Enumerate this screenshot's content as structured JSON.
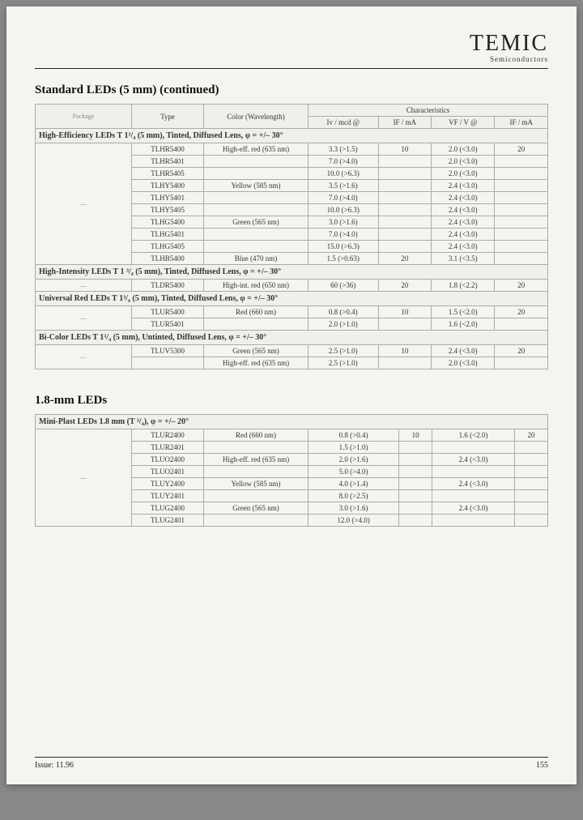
{
  "brand": {
    "name": "TEMIC",
    "sub": "Semiconductors"
  },
  "title1": "Standard LEDs (5 mm) (continued)",
  "headers": {
    "package": "Package",
    "type": "Type",
    "color": "Color (Wavelength)",
    "charGroup": "Characteristics",
    "iv": "Iv / mcd   @",
    "if": "IF / mA",
    "vf": "VF / V   @",
    "if2": "IF / mA"
  },
  "group1": {
    "title": "High-Efficiency LEDs  T 1³/₄ (5 mm), Tinted, Diffused Lens, φ = +/– 30°",
    "rows": [
      {
        "type": "TLHR5400",
        "color": "High-eff. red (635 nm)",
        "iv": "3.3 (>1.5)",
        "if": "10",
        "vf": "2.0 (<3.0)",
        "if2": "20"
      },
      {
        "type": "TLHR5401",
        "color": "",
        "iv": "7.0 (>4.0)",
        "if": "",
        "vf": "2.0 (<3.0)",
        "if2": ""
      },
      {
        "type": "TLHR5405",
        "color": "",
        "iv": "10.0 (>6.3)",
        "if": "",
        "vf": "2.0 (<3.0)",
        "if2": ""
      },
      {
        "type": "TLHY5400",
        "color": "Yellow (585 nm)",
        "iv": "3.5 (>1.6)",
        "if": "",
        "vf": "2.4 (<3.0)",
        "if2": ""
      },
      {
        "type": "TLHY5401",
        "color": "",
        "iv": "7.0 (>4.0)",
        "if": "",
        "vf": "2.4 (<3.0)",
        "if2": ""
      },
      {
        "type": "TLHY5405",
        "color": "",
        "iv": "10.0 (>6.3)",
        "if": "",
        "vf": "2.4 (<3.0)",
        "if2": ""
      },
      {
        "type": "TLHG5400",
        "color": "Green (565 nm)",
        "iv": "3.0 (>1.6)",
        "if": "",
        "vf": "2.4 (<3.0)",
        "if2": ""
      },
      {
        "type": "TLHG5401",
        "color": "",
        "iv": "7.0 (>4.0)",
        "if": "",
        "vf": "2.4 (<3.0)",
        "if2": ""
      },
      {
        "type": "TLHG5405",
        "color": "",
        "iv": "15.0 (>6.3)",
        "if": "",
        "vf": "2.4 (<3.0)",
        "if2": ""
      },
      {
        "type": "TLHB5400",
        "color": "Blue (470 nm)",
        "iv": "1.5 (>0.63)",
        "if": "20",
        "vf": "3.1 (<3.5)",
        "if2": ""
      }
    ]
  },
  "group2": {
    "title": "High-Intensity LEDs  T 1 ³/₄ (5 mm), Tinted, Diffused Lens, φ = +/– 30°",
    "rows": [
      {
        "type": "TLDR5400",
        "color": "High-int. red (650 nm)",
        "iv": "60 (>36)",
        "if": "20",
        "vf": "1.8 (<2.2)",
        "if2": "20"
      }
    ]
  },
  "group3": {
    "title": "Universal Red LEDs  T 1³/₄ (5 mm), Tinted, Diffused Lens, φ = +/– 30°",
    "rows": [
      {
        "type": "TLUR5400",
        "color": "Red (660 nm)",
        "iv": "0.8 (>0.4)",
        "if": "10",
        "vf": "1.5 (<2.0)",
        "if2": "20"
      },
      {
        "type": "TLUR5401",
        "color": "",
        "iv": "2.0 (>1.0)",
        "if": "",
        "vf": "1.6 (<2.0)",
        "if2": ""
      }
    ]
  },
  "group4": {
    "title": "Bi-Color LEDs  T 1³/₄ (5 mm), Untinted, Diffused Lens, φ = +/– 30°",
    "rows": [
      {
        "type": "TLUV5300",
        "color": "Green (565 nm)",
        "iv": "2.5 (>1.0)",
        "if": "10",
        "vf": "2.4 (<3.0)",
        "if2": "20"
      },
      {
        "type": "",
        "color": "High-eff. red (635 nm)",
        "iv": "2.5 (>1.0)",
        "if": "",
        "vf": "2.0 (<3.0)",
        "if2": ""
      }
    ]
  },
  "title2": "1.8-mm LEDs",
  "group5": {
    "title": "Mini-Plast LEDs  1.8 mm (T ³/₄),  φ = +/– 20°",
    "rows": [
      {
        "type": "TLUR2400",
        "color": "Red (660 nm)",
        "iv": "0.8 (>0.4)",
        "if": "10",
        "vf": "1.6 (<2.0)",
        "if2": "20"
      },
      {
        "type": "TLUR2401",
        "color": "",
        "iv": "1.5 (>1.0)",
        "if": "",
        "vf": "",
        "if2": ""
      },
      {
        "type": "TLUO2400",
        "color": "High-eff. red (635 nm)",
        "iv": "2.0 (>1.6)",
        "if": "",
        "vf": "2.4 (<3.0)",
        "if2": ""
      },
      {
        "type": "TLUO2401",
        "color": "",
        "iv": "5.0 (>4.0)",
        "if": "",
        "vf": "",
        "if2": ""
      },
      {
        "type": "TLUY2400",
        "color": "Yellow (585 nm)",
        "iv": "4.0 (>1.4)",
        "if": "",
        "vf": "2.4 (<3.0)",
        "if2": ""
      },
      {
        "type": "TLUY2401",
        "color": "",
        "iv": "8.0 (>2.5)",
        "if": "",
        "vf": "",
        "if2": ""
      },
      {
        "type": "TLUG2400",
        "color": "Green (565 nm)",
        "iv": "3.0 (>1.6)",
        "if": "",
        "vf": "2.4 (<3.0)",
        "if2": ""
      },
      {
        "type": "TLUG2401",
        "color": "",
        "iv": "12.0 (>4.0)",
        "if": "",
        "vf": "",
        "if2": ""
      }
    ]
  },
  "footer": {
    "issue": "Issue: 11.96",
    "page": "155"
  }
}
